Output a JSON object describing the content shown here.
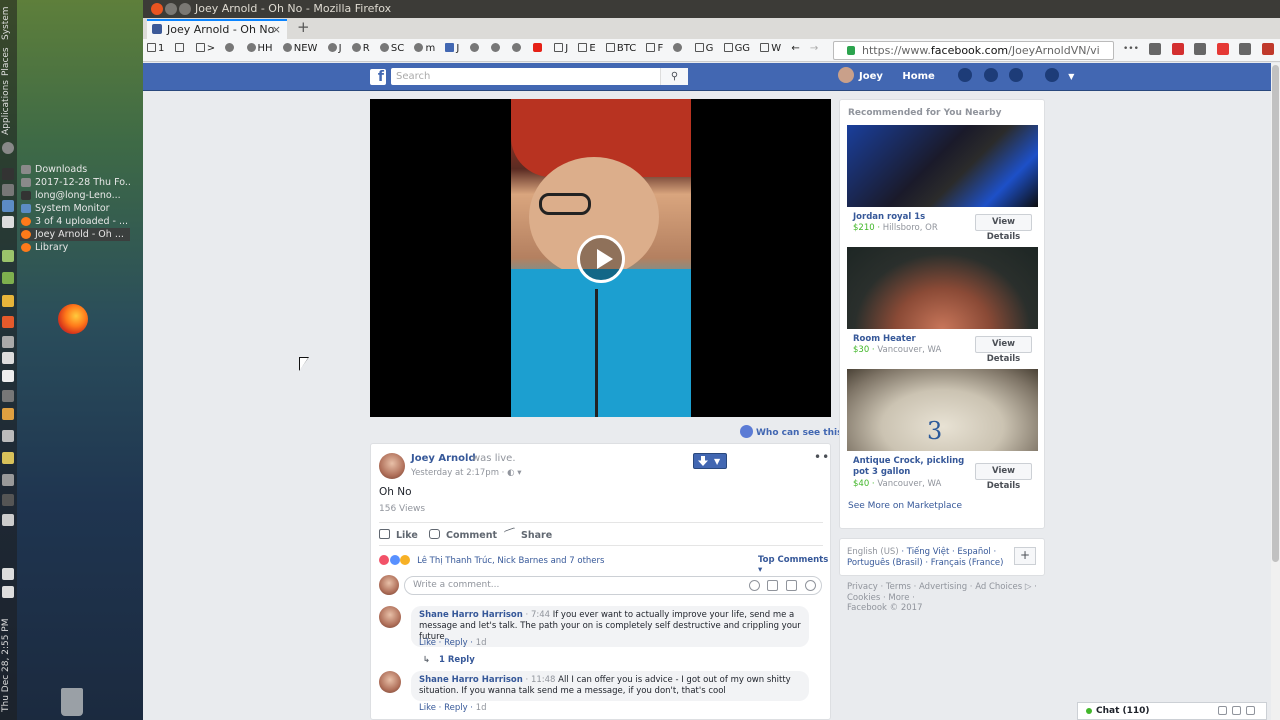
{
  "desktop": {
    "panel_labels": [
      "System",
      "Places",
      "Applications"
    ],
    "clock": "Thu Dec 28, 2:55 PM",
    "tasks": [
      {
        "label": "Downloads",
        "color": "#8a8a8a"
      },
      {
        "label": "2017-12-28 Thu Fo...",
        "color": "#8a8a8a"
      },
      {
        "label": "long@long-Leno...",
        "color": "#333333"
      },
      {
        "label": "System Monitor",
        "color": "#5c8cc4"
      },
      {
        "label": "3 of 4 uploaded - ...",
        "color": "#ff7a1a"
      },
      {
        "label": "Joey Arnold - Oh ...",
        "color": "#ff7a1a"
      },
      {
        "label": "Library",
        "color": "#ff7a1a"
      }
    ]
  },
  "browser": {
    "window_title": "Joey Arnold - Oh No - Mozilla Firefox",
    "tab_title": "Joey Arnold - Oh No",
    "new_tab": "+",
    "url_prefix": "https://www.",
    "url_domain": "facebook.com",
    "url_path": "/JoeyArnoldVN/vi",
    "page_actions": "•••",
    "bookmarks": [
      "1",
      "",
      ">",
      "",
      "HH",
      "NEW",
      "J",
      "R",
      "SC",
      "m",
      "J",
      "",
      "",
      "",
      "",
      "J",
      "E",
      "BTC",
      "F",
      "",
      "G",
      "GG",
      "W"
    ]
  },
  "facebook": {
    "logo": "f",
    "search_placeholder": "Search",
    "user_name": "Joey",
    "home_label": "Home"
  },
  "post": {
    "author": "Joey Arnold",
    "status": "was live.",
    "time": "Yesterday at 2:17pm · ◐ ▾",
    "text": "Oh No",
    "views": "156 Views",
    "like": "Like",
    "comment": "Comment",
    "share": "Share",
    "reactions": "Lê Thị Thanh Trúc, Nick Barnes and 7 others",
    "top_comments": "Top Comments ▾",
    "comment_placeholder": "Write a comment...",
    "who_can_see": "Who can see this?",
    "more": "•••"
  },
  "comments": [
    {
      "name": "Shane Harro Harrison",
      "time": "7:44",
      "text": "If you ever want to actually improve your life, send me a message and let's talk. The path your on is completely self destructive and crippling your future",
      "like": "Like",
      "reply": "Reply",
      "age": "1d",
      "replies": "1 Reply"
    },
    {
      "name": "Shane Harro Harrison",
      "time": "11:48",
      "text": "All I can offer you is advice - I got out of my own shitty situation. If you wanna talk send me a message, if you don't, that's cool",
      "like": "Like",
      "reply": "Reply",
      "age": "1d"
    }
  ],
  "marketplace": {
    "title": "Recommended for You Nearby",
    "items": [
      {
        "title": "Jordan royal 1s",
        "price": "$210",
        "location": "Hillsboro, OR",
        "button": "View Details"
      },
      {
        "title": "Room Heater",
        "price": "$30",
        "location": "Vancouver, WA",
        "button": "View Details"
      },
      {
        "title": "Antique Crock, pickling pot 3 gallon",
        "price": "$40",
        "location": "Vancouver, WA",
        "button": "View Details"
      }
    ],
    "see_more": "See More on Marketplace"
  },
  "languages": {
    "current": "English (US)",
    "line1": "Tiếng Việt · Español ·",
    "line2": "Português (Brasil) · Français (France)",
    "add": "+"
  },
  "footer": {
    "line1": "Privacy · Terms · Advertising · Ad Choices ▷ ·",
    "line2": "Cookies · More ·",
    "line3": "Facebook © 2017"
  },
  "chat": {
    "label": "Chat (110)"
  }
}
